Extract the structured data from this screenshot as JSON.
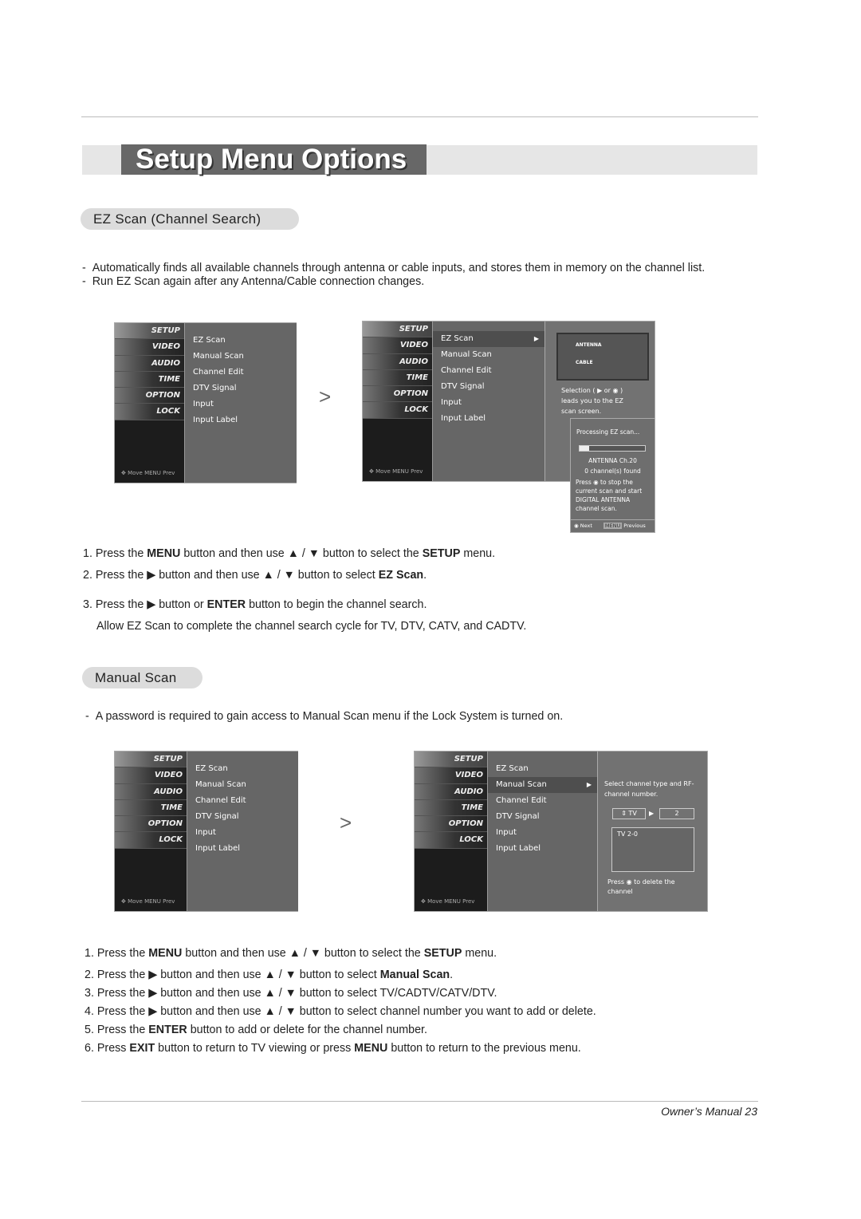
{
  "title": "Setup Menu Options",
  "sections": {
    "ez": {
      "heading": "EZ Scan (Channel Search)",
      "bullets": [
        "Automatically finds all available channels through antenna or cable inputs, and stores them in memory on the channel list.",
        "Run EZ Scan again after any Antenna/Cable connection changes."
      ],
      "steps": [
        [
          {
            "t": "1. Press the "
          },
          {
            "t": "MENU",
            "b": 1
          },
          {
            "t": " button and then use ▲ / ▼ button to select the "
          },
          {
            "t": "SETUP",
            "b": 1
          },
          {
            "t": " menu."
          }
        ],
        [
          {
            "t": "2. Press the ▶ button and then use ▲ / ▼ button to select "
          },
          {
            "t": "EZ Scan",
            "b": 1
          },
          {
            "t": "."
          }
        ],
        [
          {
            "t": "3. Press the ▶ button or "
          },
          {
            "t": "ENTER",
            "b": 1
          },
          {
            "t": " button to begin the channel search."
          }
        ],
        [
          {
            "t": "Allow EZ Scan to complete the channel search cycle for TV, DTV, CATV, and CADTV."
          }
        ]
      ]
    },
    "manual": {
      "heading": "Manual Scan",
      "bullets": [
        "A password is required to gain access to Manual Scan menu if the Lock System is turned on."
      ],
      "steps": [
        [
          {
            "t": "1. Press the "
          },
          {
            "t": "MENU",
            "b": 1
          },
          {
            "t": " button and then use ▲ / ▼ button to select the "
          },
          {
            "t": "SETUP",
            "b": 1
          },
          {
            "t": " menu."
          }
        ],
        [
          {
            "t": "2. Press the ▶ button and then use ▲ / ▼ button to select "
          },
          {
            "t": "Manual Scan",
            "b": 1
          },
          {
            "t": "."
          }
        ],
        [
          {
            "t": "3. Press the ▶ button and then use ▲ / ▼ button to select TV/CADTV/CATV/DTV."
          }
        ],
        [
          {
            "t": "4. Press the ▶ button and then use ▲ / ▼ button to select channel number you want to add or delete."
          }
        ],
        [
          {
            "t": "5. Press the  "
          },
          {
            "t": "ENTER",
            "b": 1
          },
          {
            "t": " button to add or delete for the channel number."
          }
        ],
        [
          {
            "t": "6. Press "
          },
          {
            "t": "EXIT",
            "b": 1
          },
          {
            "t": " button to return to TV viewing or press "
          },
          {
            "t": "MENU",
            "b": 1
          },
          {
            "t": " button to return to the previous menu."
          }
        ]
      ]
    }
  },
  "osd": {
    "sidebar": [
      "SETUP",
      "VIDEO",
      "AUDIO",
      "TIME",
      "OPTION",
      "LOCK"
    ],
    "footer": "✥ Move  MENU Prev",
    "menu": [
      "EZ Scan",
      "Manual Scan",
      "Channel Edit",
      "DTV Signal",
      "Input",
      "Input Label"
    ],
    "ez_right": {
      "antenna": "ANTENNA",
      "cable": "CABLE",
      "selection": "Selection ( ▶ or ◉ ) leads you to the EZ scan screen."
    },
    "ez_popup": {
      "processing": "Processing EZ scan...",
      "progress": 0.15,
      "channel": "ANTENNA Ch.20",
      "found": "0 channel(s) found",
      "press": "Press ◉ to stop the current scan and start DIGITAL ANTENNA channel scan.",
      "next": "◉ Next",
      "menu_key": "MENU",
      "previous": "Previous"
    },
    "manual_right": {
      "hint": "Select channel type and RF-channel number.",
      "type": "TV",
      "number": "2",
      "list_item": "TV 2-0",
      "press": "Press ◉  to delete the channel"
    }
  },
  "arrow": ">",
  "footer": {
    "text": "Owner’s Manual  23"
  },
  "colors": {
    "title_bg": "#676767",
    "osd_bg": "#6a6a6a"
  }
}
